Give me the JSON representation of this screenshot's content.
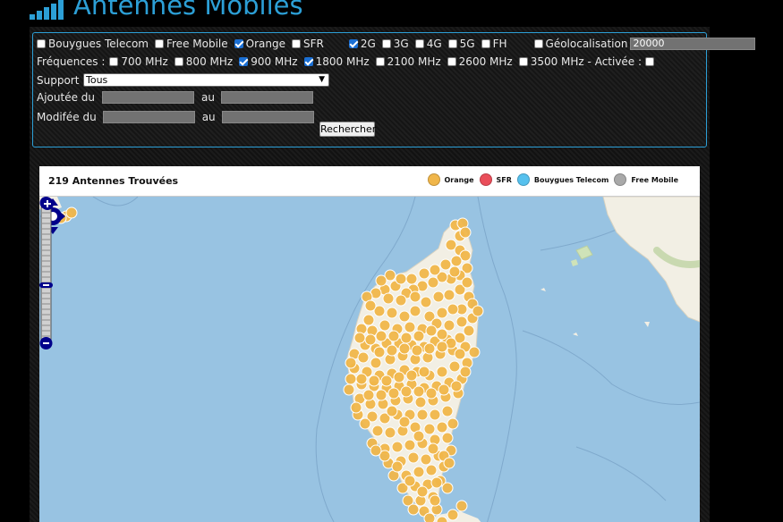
{
  "header": {
    "title": "Antennes Mobiles",
    "logo_icon": "signal-bars-icon",
    "title_color": "#2c9fd6"
  },
  "filters": {
    "operators": [
      {
        "label": "Bouygues Telecom",
        "checked": false
      },
      {
        "label": "Free Mobile",
        "checked": false
      },
      {
        "label": "Orange",
        "checked": true
      },
      {
        "label": "SFR",
        "checked": false
      }
    ],
    "technologies": [
      {
        "label": "2G",
        "checked": true
      },
      {
        "label": "3G",
        "checked": false
      },
      {
        "label": "4G",
        "checked": false
      },
      {
        "label": "5G",
        "checked": false
      },
      {
        "label": "FH",
        "checked": false
      }
    ],
    "geolocation": {
      "label": "Géolocalisation",
      "checked": false,
      "value": "20000"
    },
    "frequencies_label": "Fréquences :",
    "frequencies": [
      {
        "label": "700 MHz",
        "checked": false
      },
      {
        "label": "800 MHz",
        "checked": false
      },
      {
        "label": "900 MHz",
        "checked": true
      },
      {
        "label": "1800 MHz",
        "checked": true
      },
      {
        "label": "2100 MHz",
        "checked": false
      },
      {
        "label": "2600 MHz",
        "checked": false
      },
      {
        "label": "3500 MHz - Activée :",
        "checked": false
      }
    ],
    "freq_3500_activated": {
      "checked": false
    },
    "support": {
      "label": "Support :",
      "value": "Tous"
    },
    "added": {
      "label": "Ajoutée du",
      "to_label": "au",
      "from_value": "",
      "to_value": ""
    },
    "modified": {
      "label": "Modifée du",
      "to_label": "au",
      "from_value": "",
      "to_value": ""
    },
    "search_button": "Rechercher"
  },
  "results": {
    "count_text": "219 Antennes Trouvées",
    "legend": [
      {
        "label": "Orange",
        "color": "#f0b64a"
      },
      {
        "label": "SFR",
        "color": "#ea4e5a"
      },
      {
        "label": "Bouygues Telecom",
        "color": "#56c1ee"
      },
      {
        "label": "Free Mobile",
        "color": "#a9a9a9"
      }
    ]
  },
  "map": {
    "marker_color": "#f0b64a",
    "sea_color": "#98c3e2",
    "land_color": "#f2efe4",
    "controls": {
      "pan_icon": "pan-arrows-icon",
      "zoom_in_icon": "zoom-in-icon",
      "zoom_out_icon": "zoom-out-icon",
      "expand_icon": "plus-icon"
    }
  }
}
